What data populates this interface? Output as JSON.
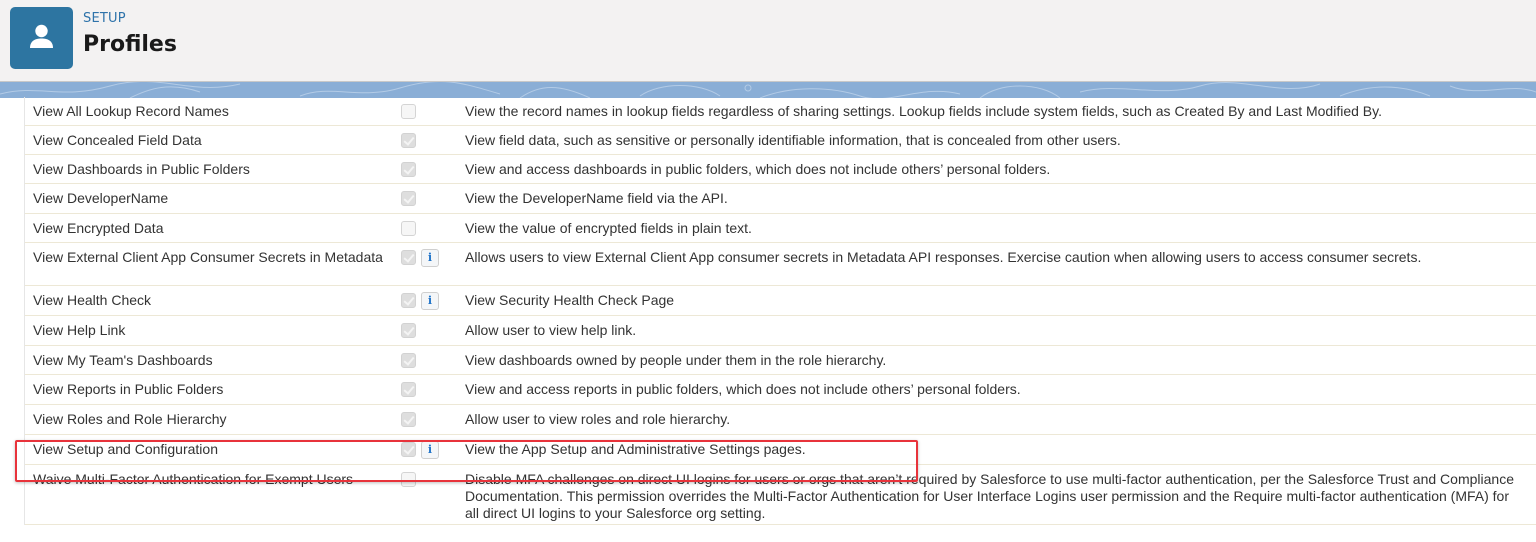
{
  "header": {
    "section": "SETUP",
    "title": "Profiles",
    "icon": "user-icon",
    "icon_bg": "#2d75a1"
  },
  "permissions": [
    {
      "name": "View All Lookup Record Names",
      "checked": false,
      "info": false,
      "description": "View the record names in lookup fields regardless of sharing settings. Lookup fields include system fields, such as Created By and Last Modified By."
    },
    {
      "name": "View Concealed Field Data",
      "checked": true,
      "info": false,
      "description": "View field data, such as sensitive or personally identifiable information, that is concealed from other users."
    },
    {
      "name": "View Dashboards in Public Folders",
      "checked": true,
      "info": false,
      "description": "View and access dashboards in public folders, which does not include others’ personal folders."
    },
    {
      "name": "View DeveloperName",
      "checked": true,
      "info": false,
      "description": "View the DeveloperName field via the API."
    },
    {
      "name": "View Encrypted Data",
      "checked": false,
      "info": false,
      "description": "View the value of encrypted fields in plain text."
    },
    {
      "name": "View External Client App Consumer Secrets in Metadata",
      "checked": true,
      "info": true,
      "description": "Allows users to view External Client App consumer secrets in Metadata API responses. Exercise caution when allowing users to access consumer secrets."
    },
    {
      "name": "View Health Check",
      "checked": true,
      "info": true,
      "description": "View Security Health Check Page"
    },
    {
      "name": "View Help Link",
      "checked": true,
      "info": false,
      "description": "Allow user to view help link."
    },
    {
      "name": "View My Team's Dashboards",
      "checked": true,
      "info": false,
      "description": "View dashboards owned by people under them in the role hierarchy."
    },
    {
      "name": "View Reports in Public Folders",
      "checked": true,
      "info": false,
      "description": "View and access reports in public folders, which does not include others’ personal folders."
    },
    {
      "name": "View Roles and Role Hierarchy",
      "checked": true,
      "info": false,
      "description": "Allow user to view roles and role hierarchy."
    },
    {
      "name": "View Setup and Configuration",
      "checked": true,
      "info": true,
      "description": "View the App Setup and Administrative Settings pages.",
      "highlighted": true
    },
    {
      "name": "Waive Multi-Factor Authentication for Exempt Users",
      "checked": false,
      "info": false,
      "description": "Disable MFA challenges on direct UI logins for users or orgs that aren’t required by Salesforce to use multi-factor authentication, per the Salesforce Trust and Compliance Documentation. This permission overrides the Multi-Factor Authentication for User Interface Logins user permission and the Require multi-factor authentication (MFA) for all direct UI logins to your Salesforce org setting."
    }
  ],
  "info_glyph": "i",
  "highlight_color": "#e8333b"
}
